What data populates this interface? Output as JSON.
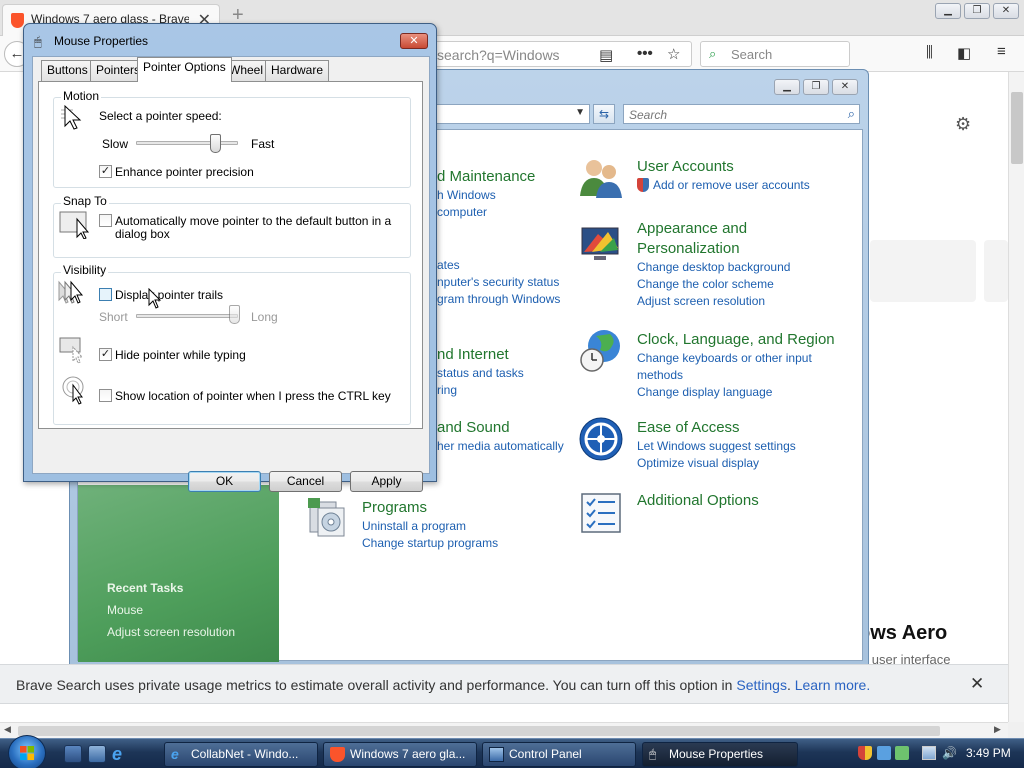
{
  "browser": {
    "tab_title": "Windows 7 aero glass - Brave S",
    "url_fragment": "search?q=Windows",
    "search_placeholder": "Search",
    "new_tab": "+"
  },
  "web_page": {
    "heading_fragment": "ows Aero",
    "subtext_fragment": "al user interface"
  },
  "control_panel": {
    "search_placeholder": "Search",
    "categories": [
      {
        "title": "d Maintenance",
        "links": [
          "h Windows",
          "computer"
        ]
      },
      {
        "title": "",
        "links": [
          "ates",
          "nputer's security status",
          "gram through Windows"
        ]
      },
      {
        "title": "nd Internet",
        "links": [
          "status and tasks",
          "ring"
        ]
      },
      {
        "title": "and Sound",
        "links": [
          "her media automatically"
        ]
      },
      {
        "title": "Programs",
        "links": [
          "Uninstall a program",
          "Change startup programs"
        ]
      },
      {
        "title": "User Accounts",
        "links": [
          "Add or remove user accounts"
        ]
      },
      {
        "title": "Appearance and Personalization",
        "links": [
          "Change desktop background",
          "Change the color scheme",
          "Adjust screen resolution"
        ]
      },
      {
        "title": "Clock, Language, and Region",
        "links": [
          "Change keyboards or other input methods",
          "Change display language"
        ]
      },
      {
        "title": "Ease of Access",
        "links": [
          "Let Windows suggest settings",
          "Optimize visual display"
        ]
      },
      {
        "title": "Additional Options",
        "links": []
      }
    ],
    "recent_tasks": {
      "title": "Recent Tasks",
      "items": [
        "Mouse",
        "Adjust screen resolution"
      ]
    }
  },
  "mouse_dialog": {
    "title": "Mouse Properties",
    "tabs": [
      "Buttons",
      "Pointers",
      "Pointer Options",
      "Wheel",
      "Hardware"
    ],
    "active_tab": "Pointer Options",
    "motion": {
      "label": "Motion",
      "speed_label": "Select a pointer speed:",
      "slow": "Slow",
      "fast": "Fast",
      "speed_value": 0.75,
      "enhance_precision": {
        "label": "Enhance pointer precision",
        "checked": true
      }
    },
    "snap_to": {
      "label": "Snap To",
      "auto_move": {
        "label": "Automatically move pointer to the default button in a dialog box",
        "line1": "Automatically move pointer to the default button in a",
        "line2": "dialog box",
        "checked": false
      }
    },
    "visibility": {
      "label": "Visibility",
      "trails": {
        "label": "Display pointer trails",
        "checked": false
      },
      "short": "Short",
      "long": "Long",
      "trail_value": 1.0,
      "hide_typing": {
        "label": "Hide pointer while typing",
        "checked": true
      },
      "show_ctrl": {
        "label": "Show location of pointer when I press the CTRL key",
        "checked": false
      }
    },
    "buttons": {
      "ok": "OK",
      "cancel": "Cancel",
      "apply": "Apply"
    }
  },
  "notification": {
    "text": "Brave Search uses private usage metrics to estimate overall activity and performance. You can turn off this option in",
    "settings_link": "Settings",
    "learn_more": "Learn more.",
    "close": "✕"
  },
  "taskbar": {
    "buttons": [
      "CollabNet - Windo...",
      "Windows 7 aero gla...",
      "Control Panel",
      "Mouse Properties"
    ],
    "active": "Mouse Properties",
    "clock": "3:49 PM"
  },
  "colors": {
    "taskbar": "#1d3557",
    "link_blue": "#1d5fb0",
    "category_green": "#21762e",
    "sidebar_green": "#4e9e5b"
  }
}
